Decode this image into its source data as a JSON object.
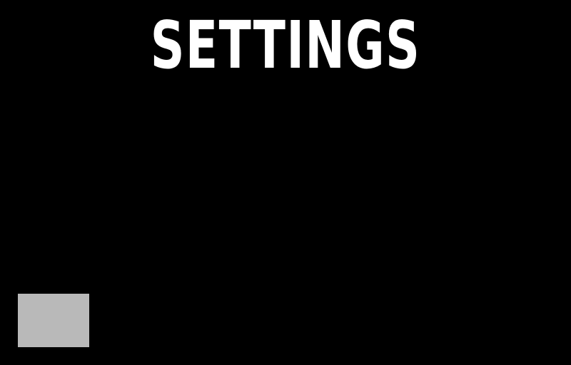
{
  "screen": {
    "title": "SETTINGS"
  },
  "colors": {
    "background": "#000000",
    "title": "#ffffff",
    "button": "#b9b9b9"
  }
}
